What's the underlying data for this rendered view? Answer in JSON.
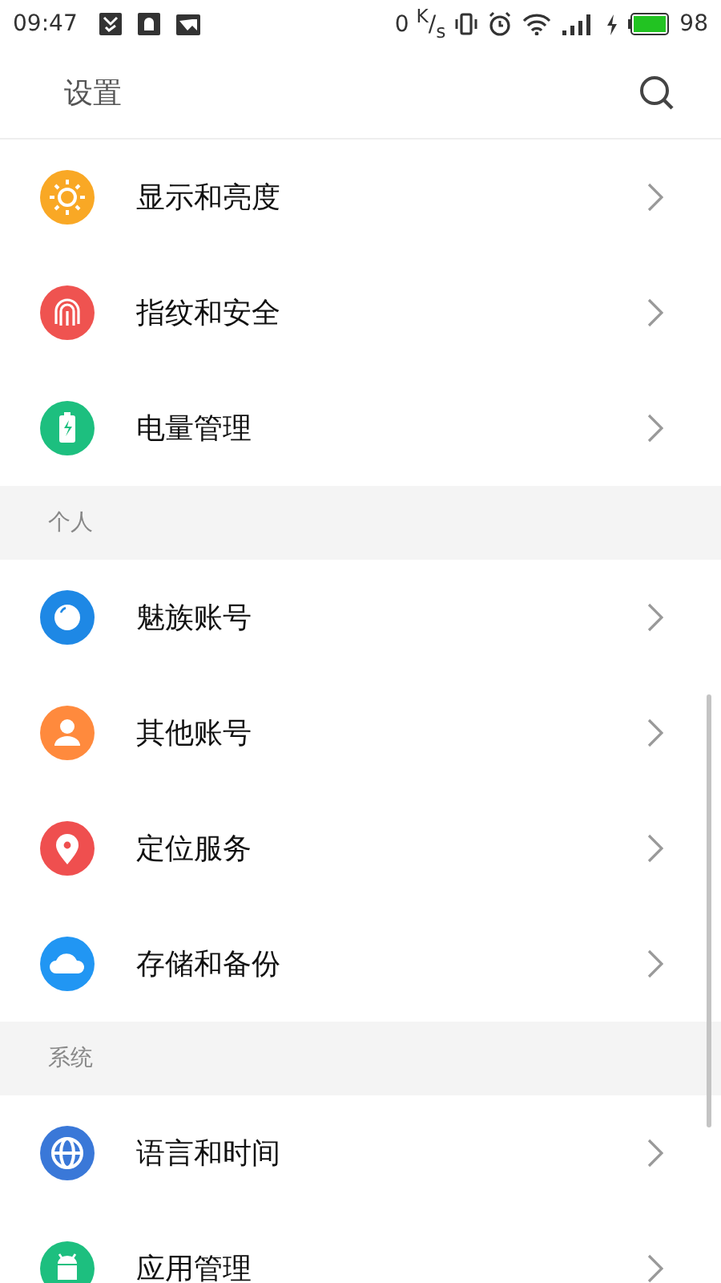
{
  "status_bar": {
    "time": "09:47",
    "speed": "0 $^{K}$/$_{s}$",
    "battery": "98"
  },
  "header": {
    "title": "设置"
  },
  "sections": [
    {
      "items": [
        {
          "label": "显示和亮度",
          "kind": "sun",
          "color": "#f9a825"
        },
        {
          "label": "指纹和安全",
          "kind": "fingerprint",
          "color": "#ef5350"
        },
        {
          "label": "电量管理",
          "kind": "battery",
          "color": "#1dbf7f"
        }
      ]
    },
    {
      "title": "个人",
      "items": [
        {
          "label": "魅族账号",
          "kind": "ring",
          "color": "#1e88e5"
        },
        {
          "label": "其他账号",
          "kind": "person",
          "color": "#ff8a3d"
        },
        {
          "label": "定位服务",
          "kind": "pin",
          "color": "#ef4f4f"
        },
        {
          "label": "存储和备份",
          "kind": "cloud",
          "color": "#2196f3"
        }
      ]
    },
    {
      "title": "系统",
      "items": [
        {
          "label": "语言和时间",
          "kind": "globe",
          "color": "#3a78d8"
        },
        {
          "label": "应用管理",
          "kind": "android",
          "color": "#1dbf7f"
        }
      ]
    }
  ]
}
